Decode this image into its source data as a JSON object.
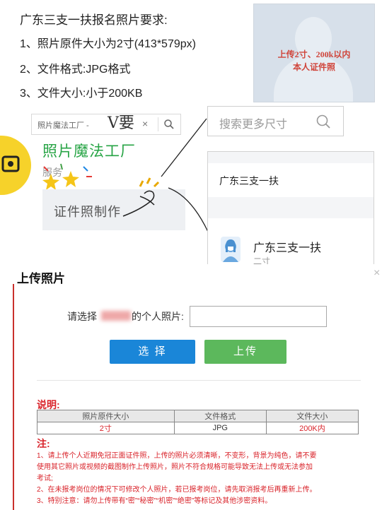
{
  "requirements": {
    "title": "广东三支一扶报名照片要求:",
    "items": [
      "1、照片原件大小为2寸(413*579px)",
      "2、文件格式:JPG格式",
      "3、文件大小:小于200KB"
    ]
  },
  "sample_photo": {
    "stamp_line1": "上传2寸、200k以内",
    "stamp_line2": "本人证件照"
  },
  "mini_app": {
    "search_text": "照片魔法工厂 - ",
    "handwritten": "V要",
    "close_glyph": "×",
    "brand_name": "照片魔法工厂",
    "brand_sub": "服务",
    "make_label": "证件照制作"
  },
  "size_search": {
    "placeholder": "搜索更多尺寸"
  },
  "results": {
    "category": "广东三支一扶",
    "item_name": "广东三支一扶",
    "item_size": "二寸"
  },
  "upload": {
    "title": "上传照片",
    "close_glyph": "×",
    "choose_prefix": "请选择",
    "choose_suffix": "的个人照片:",
    "file_value": "",
    "select_button": "选 择",
    "upload_button": "上传"
  },
  "explain": {
    "title": "说明:",
    "headers": [
      "照片原件大小",
      "文件格式",
      "文件大小"
    ],
    "row": [
      "2寸",
      "JPG",
      "200K内"
    ]
  },
  "notice": {
    "title": "注:",
    "lines": [
      "1、请上传个人近期免冠正面证件照，上传的照片必须清晰，不变形，背景为纯色，请不要",
      "使用其它照片或视频的截图制作上传照片，照片不符合规格可能导致无法上传或无法参加",
      "考试;",
      "2、在未报考岗位的情况下可修改个人照片，若已报考岗位，请先取消报考后再重新上传。",
      "3、特别注意：请勿上传带有“密”“秘密”“机密”“绝密”等标记及其他涉密资料。"
    ]
  },
  "colors": {
    "accent_blue": "#1a86d8",
    "accent_green": "#5cb85c",
    "brand_green": "#27a445",
    "warning_red": "#d9232a"
  }
}
